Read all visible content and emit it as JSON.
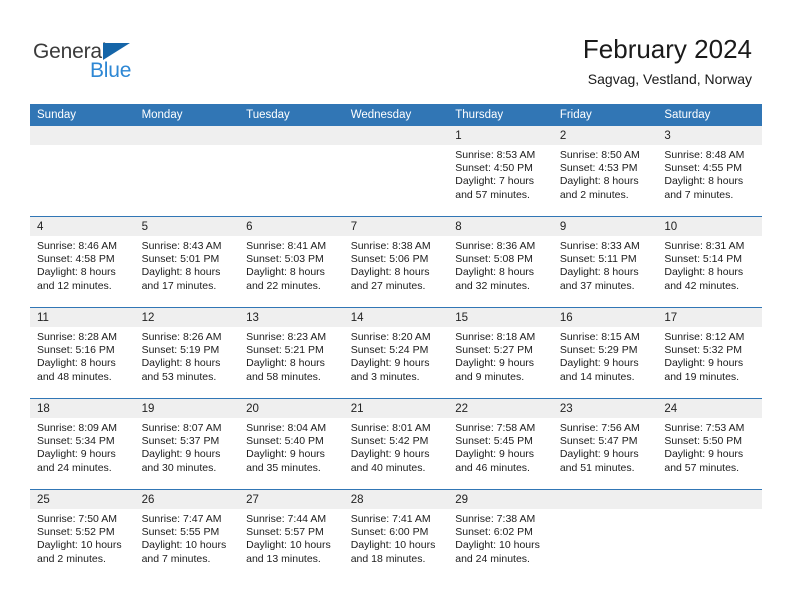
{
  "brand": {
    "name_top": "General",
    "name_bottom": "Blue",
    "triangle_color": "#1565a8",
    "blue_color": "#2d87d4"
  },
  "header": {
    "title": "February 2024",
    "subtitle": "Sagvag, Vestland, Norway"
  },
  "theme": {
    "header_bar": "#3176b5",
    "daynum_band": "#efefef",
    "text": "#1c1c1c"
  },
  "labels": {
    "sunrise_prefix": "Sunrise:",
    "sunset_prefix": "Sunset:",
    "daylight_prefix": "Daylight:"
  },
  "weekdays": [
    "Sunday",
    "Monday",
    "Tuesday",
    "Wednesday",
    "Thursday",
    "Friday",
    "Saturday"
  ],
  "weeks": [
    [
      {
        "day": "",
        "blank": true
      },
      {
        "day": "",
        "blank": true
      },
      {
        "day": "",
        "blank": true
      },
      {
        "day": "",
        "blank": true
      },
      {
        "day": "1",
        "sunrise": "Sunrise: 8:53 AM",
        "sunset": "Sunset: 4:50 PM",
        "daylight_1": "Daylight: 7 hours",
        "daylight_2": "and 57 minutes."
      },
      {
        "day": "2",
        "sunrise": "Sunrise: 8:50 AM",
        "sunset": "Sunset: 4:53 PM",
        "daylight_1": "Daylight: 8 hours",
        "daylight_2": "and 2 minutes."
      },
      {
        "day": "3",
        "sunrise": "Sunrise: 8:48 AM",
        "sunset": "Sunset: 4:55 PM",
        "daylight_1": "Daylight: 8 hours",
        "daylight_2": "and 7 minutes."
      }
    ],
    [
      {
        "day": "4",
        "sunrise": "Sunrise: 8:46 AM",
        "sunset": "Sunset: 4:58 PM",
        "daylight_1": "Daylight: 8 hours",
        "daylight_2": "and 12 minutes."
      },
      {
        "day": "5",
        "sunrise": "Sunrise: 8:43 AM",
        "sunset": "Sunset: 5:01 PM",
        "daylight_1": "Daylight: 8 hours",
        "daylight_2": "and 17 minutes."
      },
      {
        "day": "6",
        "sunrise": "Sunrise: 8:41 AM",
        "sunset": "Sunset: 5:03 PM",
        "daylight_1": "Daylight: 8 hours",
        "daylight_2": "and 22 minutes."
      },
      {
        "day": "7",
        "sunrise": "Sunrise: 8:38 AM",
        "sunset": "Sunset: 5:06 PM",
        "daylight_1": "Daylight: 8 hours",
        "daylight_2": "and 27 minutes."
      },
      {
        "day": "8",
        "sunrise": "Sunrise: 8:36 AM",
        "sunset": "Sunset: 5:08 PM",
        "daylight_1": "Daylight: 8 hours",
        "daylight_2": "and 32 minutes."
      },
      {
        "day": "9",
        "sunrise": "Sunrise: 8:33 AM",
        "sunset": "Sunset: 5:11 PM",
        "daylight_1": "Daylight: 8 hours",
        "daylight_2": "and 37 minutes."
      },
      {
        "day": "10",
        "sunrise": "Sunrise: 8:31 AM",
        "sunset": "Sunset: 5:14 PM",
        "daylight_1": "Daylight: 8 hours",
        "daylight_2": "and 42 minutes."
      }
    ],
    [
      {
        "day": "11",
        "sunrise": "Sunrise: 8:28 AM",
        "sunset": "Sunset: 5:16 PM",
        "daylight_1": "Daylight: 8 hours",
        "daylight_2": "and 48 minutes."
      },
      {
        "day": "12",
        "sunrise": "Sunrise: 8:26 AM",
        "sunset": "Sunset: 5:19 PM",
        "daylight_1": "Daylight: 8 hours",
        "daylight_2": "and 53 minutes."
      },
      {
        "day": "13",
        "sunrise": "Sunrise: 8:23 AM",
        "sunset": "Sunset: 5:21 PM",
        "daylight_1": "Daylight: 8 hours",
        "daylight_2": "and 58 minutes."
      },
      {
        "day": "14",
        "sunrise": "Sunrise: 8:20 AM",
        "sunset": "Sunset: 5:24 PM",
        "daylight_1": "Daylight: 9 hours",
        "daylight_2": "and 3 minutes."
      },
      {
        "day": "15",
        "sunrise": "Sunrise: 8:18 AM",
        "sunset": "Sunset: 5:27 PM",
        "daylight_1": "Daylight: 9 hours",
        "daylight_2": "and 9 minutes."
      },
      {
        "day": "16",
        "sunrise": "Sunrise: 8:15 AM",
        "sunset": "Sunset: 5:29 PM",
        "daylight_1": "Daylight: 9 hours",
        "daylight_2": "and 14 minutes."
      },
      {
        "day": "17",
        "sunrise": "Sunrise: 8:12 AM",
        "sunset": "Sunset: 5:32 PM",
        "daylight_1": "Daylight: 9 hours",
        "daylight_2": "and 19 minutes."
      }
    ],
    [
      {
        "day": "18",
        "sunrise": "Sunrise: 8:09 AM",
        "sunset": "Sunset: 5:34 PM",
        "daylight_1": "Daylight: 9 hours",
        "daylight_2": "and 24 minutes."
      },
      {
        "day": "19",
        "sunrise": "Sunrise: 8:07 AM",
        "sunset": "Sunset: 5:37 PM",
        "daylight_1": "Daylight: 9 hours",
        "daylight_2": "and 30 minutes."
      },
      {
        "day": "20",
        "sunrise": "Sunrise: 8:04 AM",
        "sunset": "Sunset: 5:40 PM",
        "daylight_1": "Daylight: 9 hours",
        "daylight_2": "and 35 minutes."
      },
      {
        "day": "21",
        "sunrise": "Sunrise: 8:01 AM",
        "sunset": "Sunset: 5:42 PM",
        "daylight_1": "Daylight: 9 hours",
        "daylight_2": "and 40 minutes."
      },
      {
        "day": "22",
        "sunrise": "Sunrise: 7:58 AM",
        "sunset": "Sunset: 5:45 PM",
        "daylight_1": "Daylight: 9 hours",
        "daylight_2": "and 46 minutes."
      },
      {
        "day": "23",
        "sunrise": "Sunrise: 7:56 AM",
        "sunset": "Sunset: 5:47 PM",
        "daylight_1": "Daylight: 9 hours",
        "daylight_2": "and 51 minutes."
      },
      {
        "day": "24",
        "sunrise": "Sunrise: 7:53 AM",
        "sunset": "Sunset: 5:50 PM",
        "daylight_1": "Daylight: 9 hours",
        "daylight_2": "and 57 minutes."
      }
    ],
    [
      {
        "day": "25",
        "sunrise": "Sunrise: 7:50 AM",
        "sunset": "Sunset: 5:52 PM",
        "daylight_1": "Daylight: 10 hours",
        "daylight_2": "and 2 minutes."
      },
      {
        "day": "26",
        "sunrise": "Sunrise: 7:47 AM",
        "sunset": "Sunset: 5:55 PM",
        "daylight_1": "Daylight: 10 hours",
        "daylight_2": "and 7 minutes."
      },
      {
        "day": "27",
        "sunrise": "Sunrise: 7:44 AM",
        "sunset": "Sunset: 5:57 PM",
        "daylight_1": "Daylight: 10 hours",
        "daylight_2": "and 13 minutes."
      },
      {
        "day": "28",
        "sunrise": "Sunrise: 7:41 AM",
        "sunset": "Sunset: 6:00 PM",
        "daylight_1": "Daylight: 10 hours",
        "daylight_2": "and 18 minutes."
      },
      {
        "day": "29",
        "sunrise": "Sunrise: 7:38 AM",
        "sunset": "Sunset: 6:02 PM",
        "daylight_1": "Daylight: 10 hours",
        "daylight_2": "and 24 minutes."
      },
      {
        "day": "",
        "blank": true
      },
      {
        "day": "",
        "blank": true
      }
    ]
  ]
}
